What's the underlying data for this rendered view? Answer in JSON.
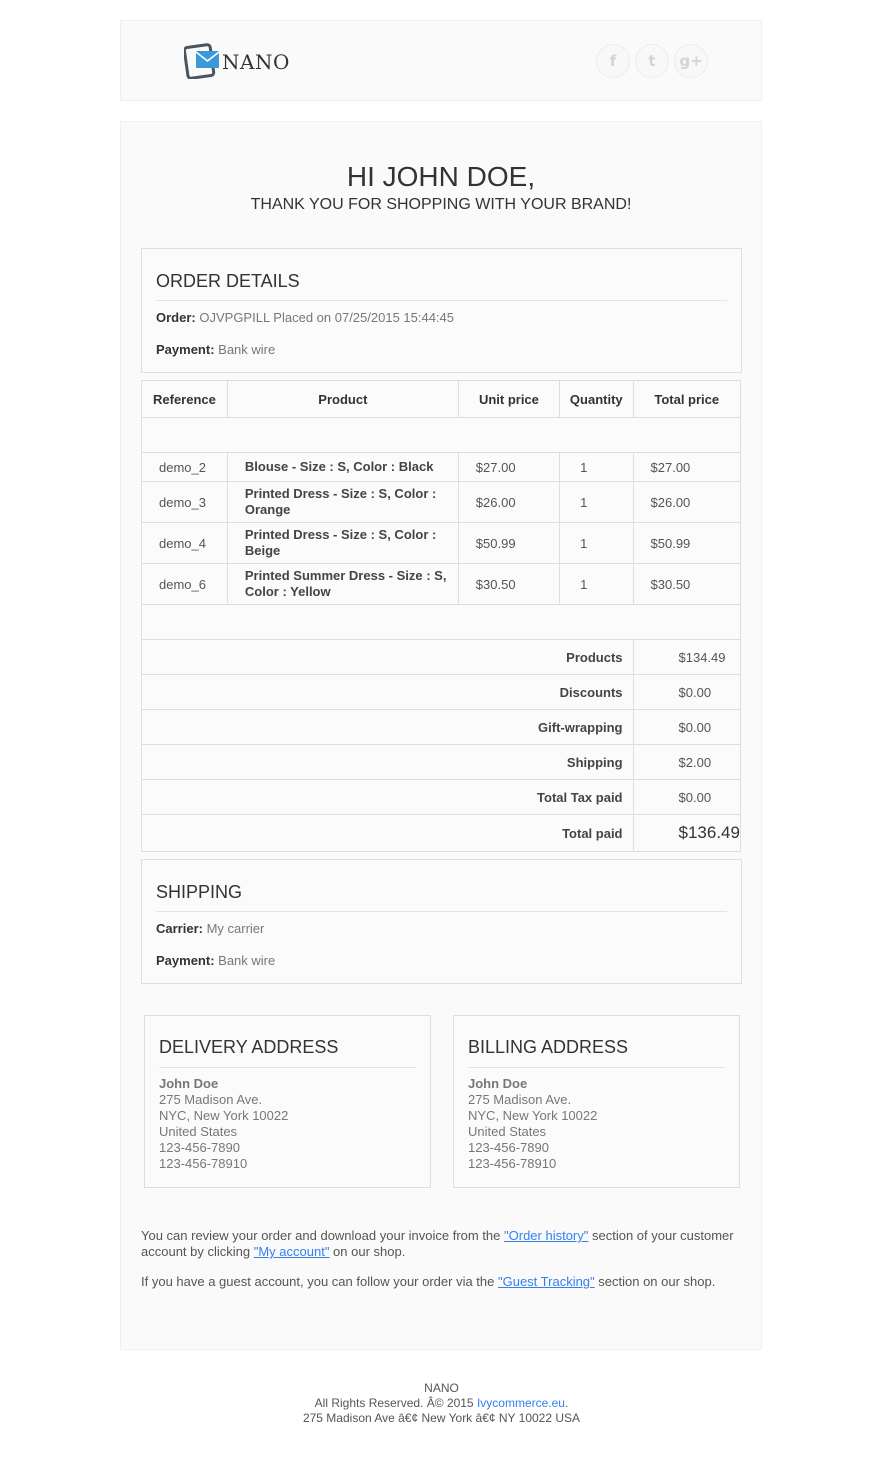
{
  "brand": {
    "name": "NANO"
  },
  "social": {
    "facebook": "f",
    "twitter": "t",
    "google_plus": "g+"
  },
  "greeting": {
    "title": "HI JOHN DOE,",
    "subtitle": "THANK YOU FOR SHOPPING WITH YOUR BRAND!"
  },
  "order_details": {
    "title": "ORDER DETAILS",
    "order_label": "Order:",
    "order_value": "OJVPGPILL Placed on 07/25/2015 15:44:45",
    "payment_label": "Payment:",
    "payment_value": "Bank wire"
  },
  "table": {
    "headers": [
      "Reference",
      "Product",
      "Unit price",
      "Quantity",
      "Total price"
    ],
    "rows": [
      {
        "reference": "demo_2",
        "product": "Blouse - Size : S, Color : Black",
        "unit_price": "$27.00",
        "quantity": "1",
        "total": "$27.00"
      },
      {
        "reference": "demo_3",
        "product": "Printed Dress - Size : S, Color : Orange",
        "unit_price": "$26.00",
        "quantity": "1",
        "total": "$26.00"
      },
      {
        "reference": "demo_4",
        "product": "Printed Dress - Size : S, Color : Beige",
        "unit_price": "$50.99",
        "quantity": "1",
        "total": "$50.99"
      },
      {
        "reference": "demo_6",
        "product": "Printed Summer Dress - Size : S, Color : Yellow",
        "unit_price": "$30.50",
        "quantity": "1",
        "total": "$30.50"
      }
    ],
    "summary": [
      {
        "label": "Products",
        "value": "$134.49"
      },
      {
        "label": "Discounts",
        "value": "$0.00"
      },
      {
        "label": "Gift-wrapping",
        "value": "$0.00"
      },
      {
        "label": "Shipping",
        "value": "$2.00"
      },
      {
        "label": "Total Tax paid",
        "value": "$0.00"
      },
      {
        "label": "Total paid",
        "value": "$136.49"
      }
    ]
  },
  "shipping": {
    "title": "SHIPPING",
    "carrier_label": "Carrier:",
    "carrier_value": "My carrier",
    "payment_label": "Payment:",
    "payment_value": "Bank wire"
  },
  "delivery_address": {
    "title": "DELIVERY ADDRESS",
    "name": "John Doe",
    "street": "275 Madison Ave.",
    "city": "NYC, New York 10022",
    "country": "United States",
    "phone": "123-456-7890",
    "mobile": "123-456-78910"
  },
  "billing_address": {
    "title": "BILLING ADDRESS",
    "name": "John Doe",
    "street": "275 Madison Ave.",
    "city": "NYC, New York 10022",
    "country": "United States",
    "phone": "123-456-7890",
    "mobile": "123-456-78910"
  },
  "notes": {
    "p1_part1": "You can review your order and download your invoice from the ",
    "order_history_link": "\"Order history\"",
    "p1_part2": " section of your customer account by clicking ",
    "my_account_link": "\"My account\"",
    "p1_part3": " on our shop.",
    "p2_part1": "If you have a guest account, you can follow your order via the ",
    "guest_tracking_link": "\"Guest Tracking\"",
    "p2_part2": " section on our shop."
  },
  "footer": {
    "brand": "NANO",
    "rights_prefix": "All Rights Reserved. Â© 2015 ",
    "rights_link": "Ivycommerce.eu",
    "rights_suffix": ".",
    "address": "275 Madison Ave â€¢ New York â€¢ NY 10022 USA"
  },
  "colors": {
    "link": "#337ff1",
    "logo_blue": "#3a9ad9",
    "logo_dark": "#4a5560"
  }
}
